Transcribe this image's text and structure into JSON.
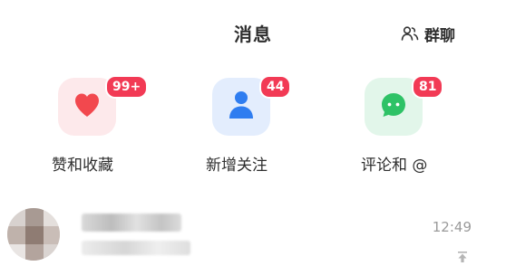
{
  "header": {
    "title": "消息",
    "group_chat_label": "群聊",
    "group_chat_icon": "group-user-icon"
  },
  "categories": [
    {
      "label": "赞和收藏",
      "badge": "99+",
      "icon": "heart-icon",
      "color": "#f2484e"
    },
    {
      "label": "新增关注",
      "badge": "44",
      "icon": "person-icon",
      "color": "#2f7df0"
    },
    {
      "label": "评论和 @",
      "badge": "81",
      "icon": "chat-bubble-icon",
      "color": "#2ec266"
    }
  ],
  "conversation": {
    "time": "12:49",
    "pin_icon": "pin-top-icon"
  },
  "colors": {
    "badge": "#f23a55",
    "text": "#2e2e2e",
    "muted": "#9a9a9a"
  }
}
